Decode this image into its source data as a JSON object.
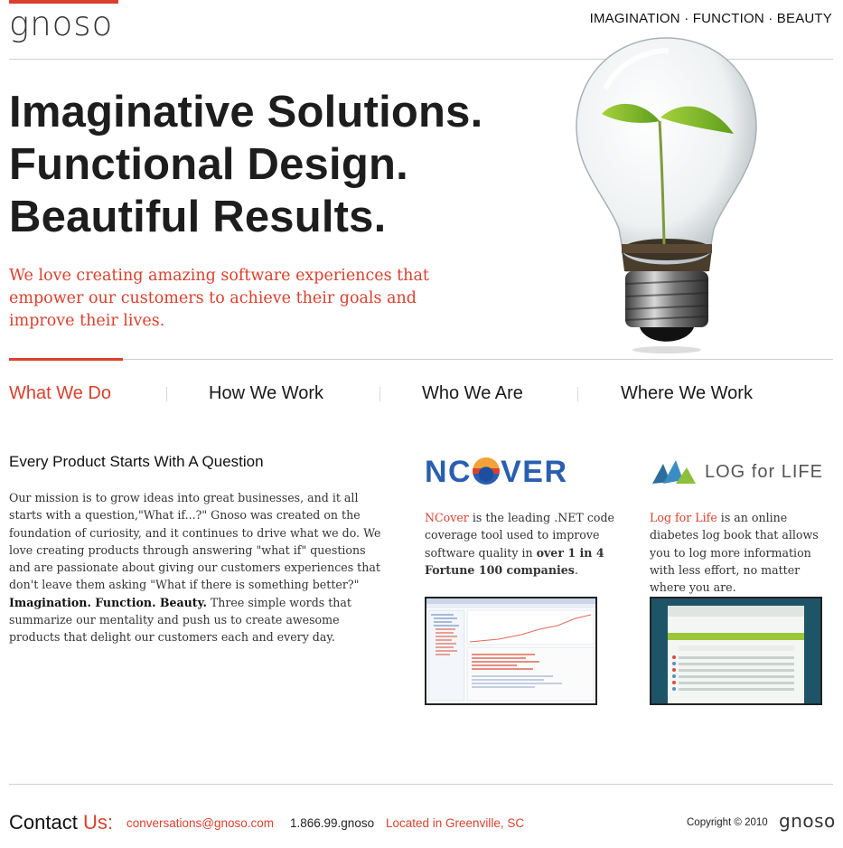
{
  "brand": {
    "logo": "gnoso",
    "accent_color": "#d9412e"
  },
  "header": {
    "tagline": "IMAGINATION · FUNCTION · BEAUTY"
  },
  "hero": {
    "line1": "Imaginative Solutions.",
    "line2": "Functional Design.",
    "line3": "Beautiful Results.",
    "lead": "We love creating amazing software experiences that empower our customers to achieve their goals and improve their lives.",
    "image_icon": "lightbulb-with-sprout"
  },
  "nav": {
    "items": [
      {
        "label": "What We Do",
        "active": true
      },
      {
        "label": "How We Work",
        "active": false
      },
      {
        "label": "Who We Are",
        "active": false
      },
      {
        "label": "Where We Work",
        "active": false
      }
    ]
  },
  "intro": {
    "heading": "Every Product Starts With A Question",
    "p1": "Our mission is to grow ideas into great businesses, and it all starts with a question,\"What if...?\" Gnoso was created on the foundation of curiosity, and it continues to drive what we do. We love creating products through answering \"what if\" questions and are passionate about giving our customers experiences that don't leave them asking \"What if there is something better?\" ",
    "bold1": "Imagination. Function. Beauty.",
    "p2": " Three simple words that summarize our mentality and push us to create awesome products that delight our customers each and every day."
  },
  "ncover": {
    "logo_n": "NC",
    "logo_rest": "VER",
    "link": "NCover",
    "text": " is the leading .NET code coverage tool used to improve software quality in ",
    "bold": "over 1 in 4 Fortune 100 companies",
    "end": "."
  },
  "logforlife": {
    "logo_text": "LOG for LIFE",
    "link": "Log for Life",
    "text": " is an online diabetes log book that allows you to log more information with less effort, no matter where you are."
  },
  "footer": {
    "contact": "Contact",
    "us": "Us:",
    "email": "conversations@gnoso.com",
    "phone": "1.866.99.gnoso",
    "location": "Located in Greenville, SC",
    "copyright": "Copyright © 2010",
    "logo": "gnoso"
  }
}
